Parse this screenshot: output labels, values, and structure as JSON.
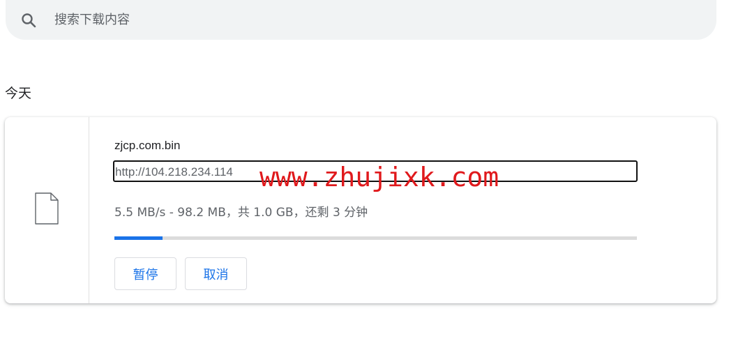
{
  "search": {
    "placeholder": "搜索下载内容",
    "icon": "search-icon"
  },
  "section": {
    "date_heading": "今天"
  },
  "download": {
    "file_name": "zjcp.com.bin",
    "url": "http://104.218.234.114",
    "status": "5.5 MB/s - 98.2 MB，共 1.0 GB，还剩 3 分钟",
    "progress_fraction": 0.092,
    "file_icon": "file-icon",
    "pause_label": "暂停",
    "cancel_label": "取消"
  },
  "watermark": {
    "text": "www.zhujixk.com",
    "color": "#e0191c"
  },
  "colors": {
    "accent": "#1a73e8",
    "search_bg": "#f1f3f4"
  }
}
